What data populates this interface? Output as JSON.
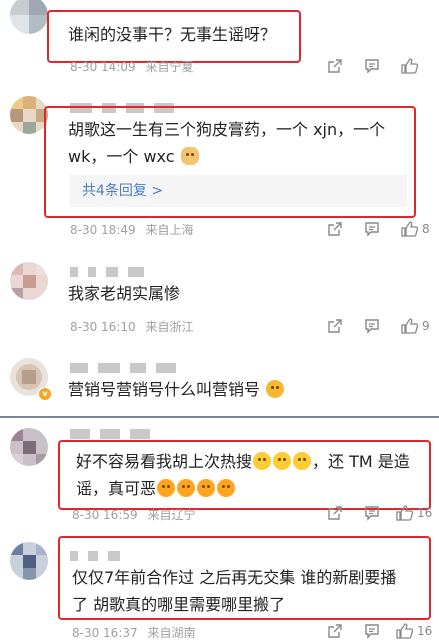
{
  "comments": [
    {
      "text": "谁闲的没事干？无事生谣呀？",
      "time": "8-30 14:09",
      "location": "来自宁夏",
      "likes": ""
    },
    {
      "text_line1": "胡歌这一生有三个狗皮膏药，一个 xjn，一个",
      "text_line2": "wk，一个 wxc",
      "emoji": "dog-emoji",
      "reply_label": "共4条回复 >",
      "time": "8-30 18:49",
      "location": "来自上海",
      "likes": "8"
    },
    {
      "text": "我家老胡实属惨",
      "time": "8-30 16:10",
      "location": "来自浙江",
      "likes": "9"
    },
    {
      "text": "营销号营销号什么叫营销号",
      "emoji": "hug-emoji",
      "badge": "v"
    },
    {
      "text_line1_a": "好不容易看我胡上次热搜",
      "text_line1_b": "，还 TM 是造",
      "text_line2": "谣，真可恶",
      "time": "8-30 16:59",
      "location": "来自辽宁",
      "likes": "16"
    },
    {
      "text_line1": "仅仅7年前合作过 之后再无交集  谁的新剧要播",
      "text_line2": "了 胡歌真的哪里需要哪里搬了",
      "time": "8-30 16:37",
      "location": "来自湖南",
      "likes": "16"
    }
  ],
  "icons": {
    "share": "share-icon",
    "comment": "comment-icon",
    "like": "like-icon"
  },
  "colors": {
    "highlight_border": "#e0272c",
    "reply_link": "#4a7fbf",
    "meta_text": "#a0a0a0"
  }
}
